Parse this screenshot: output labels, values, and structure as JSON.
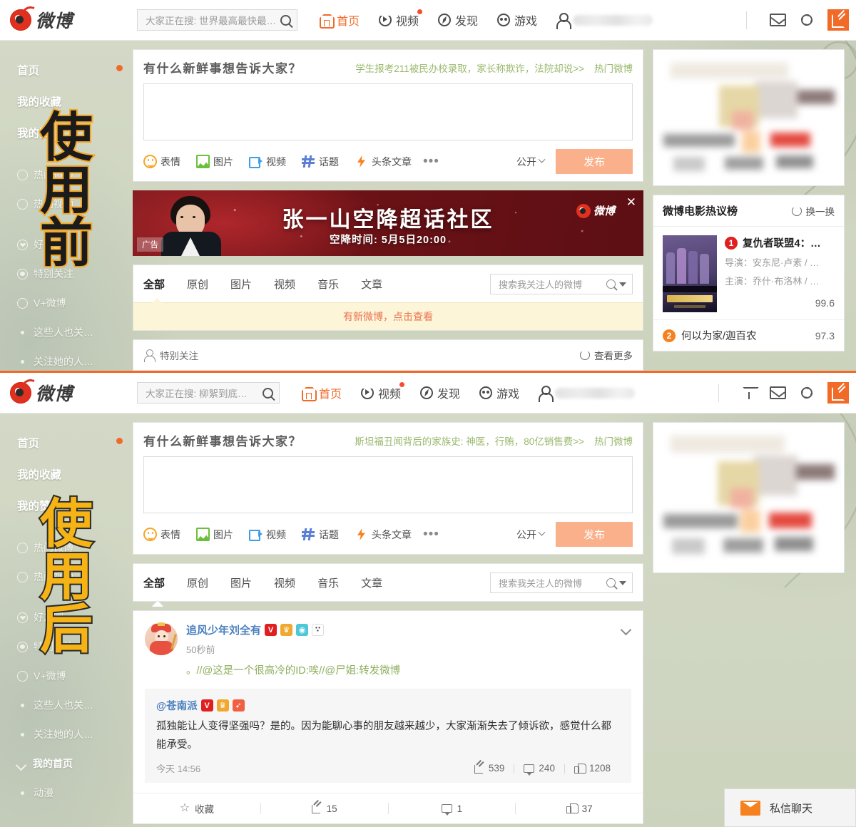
{
  "header_top": {
    "brand": "微博",
    "search_placeholder": "大家正在搜: 世界最高最快最…",
    "nav": [
      {
        "label": "首页",
        "icon": "home-icon",
        "active": true,
        "dot": false
      },
      {
        "label": "视频",
        "icon": "video-icon",
        "active": false,
        "dot": true
      },
      {
        "label": "发现",
        "icon": "compass-icon",
        "active": false,
        "dot": false
      },
      {
        "label": "游戏",
        "icon": "game-icon",
        "active": false,
        "dot": false
      }
    ],
    "username_masked": "",
    "right_icons": [
      "mail-icon",
      "gear-icon",
      "compose-icon"
    ]
  },
  "header_bottom": {
    "brand": "微博",
    "search_placeholder": "大家正在搜: 柳絮到底…",
    "nav": [
      {
        "label": "首页",
        "icon": "home-icon",
        "active": true,
        "dot": false
      },
      {
        "label": "视频",
        "icon": "video-icon",
        "active": false,
        "dot": true
      },
      {
        "label": "发现",
        "icon": "compass-icon",
        "active": false,
        "dot": false
      },
      {
        "label": "游戏",
        "icon": "game-icon",
        "active": false,
        "dot": false
      }
    ],
    "username_masked": "",
    "right_icons": [
      "funnel-icon",
      "mail-icon",
      "gear-icon",
      "compose-icon"
    ]
  },
  "sidebar": {
    "headings": [
      "首页",
      "我的收藏",
      "我的赞"
    ],
    "items": [
      {
        "label": "热门微博",
        "icon": "flame-icon"
      },
      {
        "label": "热门视频",
        "icon": "play-icon"
      },
      {
        "label": "好友圈",
        "icon": "heart-icon"
      },
      {
        "label": "特别关注",
        "icon": "target-icon"
      },
      {
        "label": "V+微博",
        "icon": "vplus-icon"
      },
      {
        "label": "这些人也关…",
        "icon": "bullet"
      },
      {
        "label": "关注她的人…",
        "icon": "bullet"
      },
      {
        "label": "我的首页",
        "icon": "chevron-icon"
      },
      {
        "label": "动漫",
        "icon": "bullet"
      }
    ]
  },
  "overlay": {
    "before": "使用前",
    "after": "使用后"
  },
  "composer_top": {
    "prompt": "有什么新鲜事想告诉大家？",
    "trend_text": "学生报考211被民办校录取，家长称欺诈，法院却说>>",
    "trend_tag": "热门微博",
    "textarea_value": "",
    "tools": [
      {
        "label": "表情",
        "icon": "emoji-icon"
      },
      {
        "label": "图片",
        "icon": "image-icon"
      },
      {
        "label": "视频",
        "icon": "video-icon"
      },
      {
        "label": "话题",
        "icon": "hashtag-icon"
      },
      {
        "label": "头条文章",
        "icon": "bolt-icon"
      }
    ],
    "more": "•••",
    "privacy": "公开",
    "submit": "发布"
  },
  "composer_bottom": {
    "prompt": "有什么新鲜事想告诉大家？",
    "trend_text": "斯坦福丑闻背后的家族史: 神医，行贿，80亿销售费>>",
    "trend_tag": "热门微博",
    "textarea_value": "",
    "tools": [
      {
        "label": "表情",
        "icon": "emoji-icon"
      },
      {
        "label": "图片",
        "icon": "image-icon"
      },
      {
        "label": "视频",
        "icon": "video-icon"
      },
      {
        "label": "话题",
        "icon": "hashtag-icon"
      },
      {
        "label": "头条文章",
        "icon": "bolt-icon"
      }
    ],
    "more": "•••",
    "privacy": "公开",
    "submit": "发布"
  },
  "ad": {
    "title": "张一山空降超话社区",
    "subtitle": "空降时间: 5月5日20:00",
    "tag": "广告",
    "brand": "微博",
    "close": "✕"
  },
  "tabs_top": {
    "items": [
      "全部",
      "原创",
      "图片",
      "视频",
      "音乐",
      "文章"
    ],
    "active": "全部",
    "search_placeholder": "搜索我关注人的微博"
  },
  "tabs_bottom": {
    "items": [
      "全部",
      "原创",
      "图片",
      "视频",
      "音乐",
      "文章"
    ],
    "active": "全部",
    "search_placeholder": "搜索我关注人的微博"
  },
  "notice": {
    "text": "有新微博，点击查看"
  },
  "special_strip": {
    "label": "特别关注",
    "more": "查看更多"
  },
  "post": {
    "author": "追风少年刘全有",
    "badges": [
      "V",
      "club",
      "camera",
      "panda"
    ],
    "time": "50秒前",
    "text": "。//@这是一个很高冷的ID:唉//@尸姐:转发微博",
    "quote": {
      "author": "@苍南派",
      "badges": [
        "V",
        "club",
        "rocket"
      ],
      "body": "孤独能让人变得坚强吗？是的。因为能聊心事的朋友越来越少，大家渐渐失去了倾诉欲，感觉什么都能承受。",
      "time": "今天 14:56",
      "shares": "539",
      "comments": "240",
      "likes": "1208"
    },
    "actions": [
      {
        "label": "收藏",
        "icon": "star-icon"
      },
      {
        "label": "15",
        "icon": "share-icon"
      },
      {
        "label": "1",
        "icon": "comment-icon"
      },
      {
        "label": "37",
        "icon": "like-icon"
      }
    ]
  },
  "movie_rank": {
    "title": "微博电影热议榜",
    "refresh": "换一换",
    "entries": [
      {
        "rank": "1",
        "name": "复仇者联盟4：…",
        "director": "导演：安东尼·卢素 / …",
        "cast": "主演：乔什·布洛林 / …",
        "score": "99.6"
      },
      {
        "rank": "2",
        "name": "何以为家/迦百农",
        "score": "97.3"
      }
    ]
  },
  "chat_widget": {
    "label": "私信聊天",
    "icon": "mail-icon"
  },
  "colors": {
    "accent": "#f26a28",
    "brand_red": "#e03020",
    "page_bg": "#cfd6c0",
    "trend_green": "#9ab86c",
    "notice_bg": "#fcf5d8",
    "notice_text": "#eb7350",
    "stamp_before": "#1b1b1b",
    "stamp_after": "#f5b315"
  }
}
